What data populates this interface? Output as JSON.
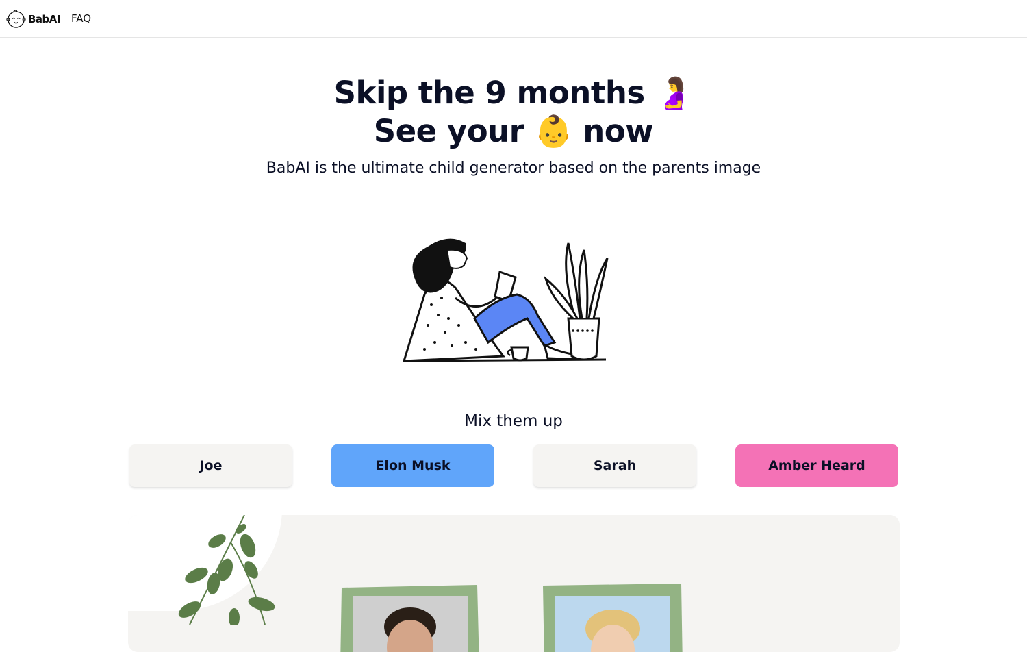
{
  "nav": {
    "logo_text": "BabAI",
    "faq_label": "FAQ"
  },
  "hero": {
    "title_line1": "Skip the 9 months 🤰",
    "title_line2": "See your 👶 now",
    "subtitle": "BabAI is the ultimate child generator based on the parents image"
  },
  "mix": {
    "label": "Mix them up",
    "people": [
      {
        "label": "Joe",
        "color": "#f5f4f2"
      },
      {
        "label": "Elon Musk",
        "color": "#60a5fa"
      },
      {
        "label": "Sarah",
        "color": "#f5f4f2"
      },
      {
        "label": "Amber Heard",
        "color": "#f472b6"
      }
    ]
  },
  "colors": {
    "text": "#0b1026",
    "accent_blue": "#60a5fa",
    "accent_pink": "#f472b6",
    "panel": "#f5f4f2",
    "frame_green": "#93b384",
    "leaf_green": "#5b7d48"
  }
}
